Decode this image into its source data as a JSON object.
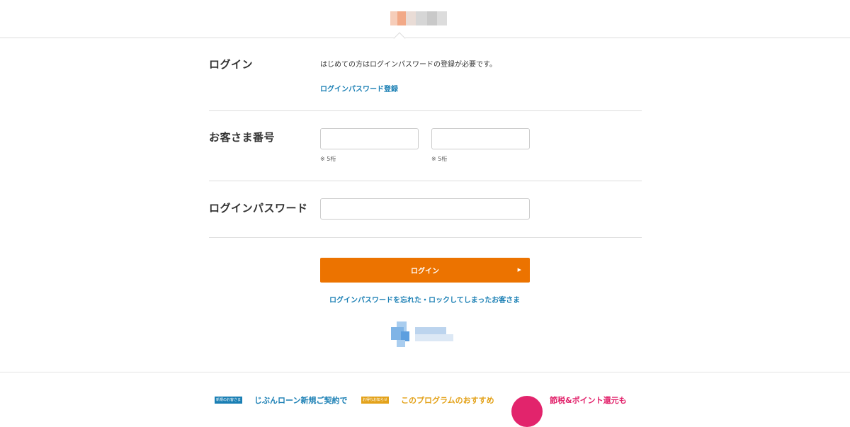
{
  "header": {
    "logo": "じぶん銀行"
  },
  "login_section": {
    "label": "ログイン",
    "intro": "はじめての方はログインパスワードの登録が必要です。",
    "register_link": "ログインパスワード登録"
  },
  "customer_number": {
    "label": "お客さま番号",
    "field1": {
      "value": "",
      "hint": "※ 5桁"
    },
    "field2": {
      "value": "",
      "hint": "※ 5桁"
    }
  },
  "password": {
    "label": "ログインパスワード",
    "value": ""
  },
  "login_button": {
    "label": "ログイン",
    "arrow": "▶"
  },
  "forgot_link": "ログインパスワードを忘れた・ロックしてしまったお客さま",
  "footer_banners": [
    {
      "tag": "新規のお客さま",
      "text": "じぶんローン新規ご契約で",
      "tag_color": "#1a7fb4",
      "text_color": "#1a7fb4"
    },
    {
      "tag": "お得なお知らせ",
      "text": "このプログラムのおすすめ",
      "tag_color": "#e3a21a",
      "text_color": "#e3a21a"
    },
    {
      "tag": "",
      "text": "節税&ポイント還元も",
      "tag_color": "#e2246c",
      "text_color": "#e2246c"
    }
  ],
  "colors": {
    "accent": "#ec7300",
    "link": "#1a7fb4",
    "divider": "#dddddd"
  }
}
